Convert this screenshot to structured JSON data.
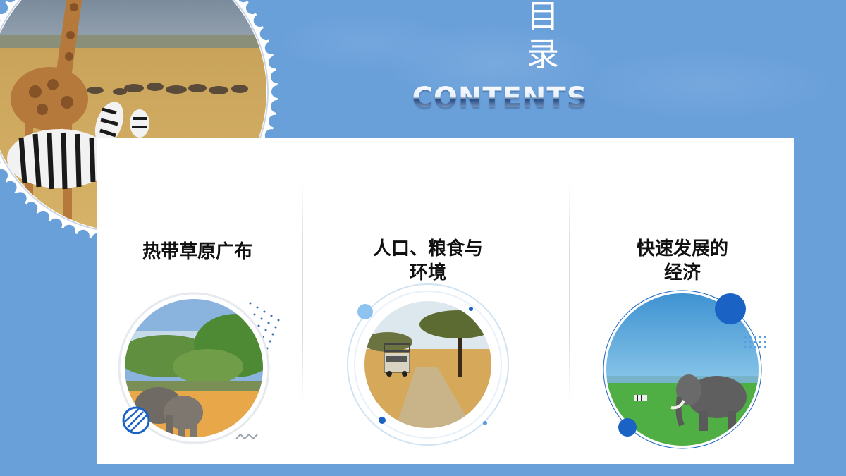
{
  "title": {
    "cn_line1": "目",
    "cn_line2": "录",
    "en": "CONTENTS"
  },
  "items": [
    {
      "line1": "热带草原广布",
      "line2": "",
      "image": "savanna-trees-elephants-photo"
    },
    {
      "line1": "人口、粮食与",
      "line2": "环境",
      "image": "safari-jeep-acacia-photo"
    },
    {
      "line1": "快速发展的",
      "line2": "经济",
      "image": "elephant-zebra-grassland-photo"
    }
  ],
  "header_image": "giraffe-zebra-savanna-stamp-photo",
  "colors": {
    "background": "#6aa0da",
    "card": "#ffffff",
    "accent": "#1a63c4",
    "light_accent": "#8ec3f0"
  }
}
